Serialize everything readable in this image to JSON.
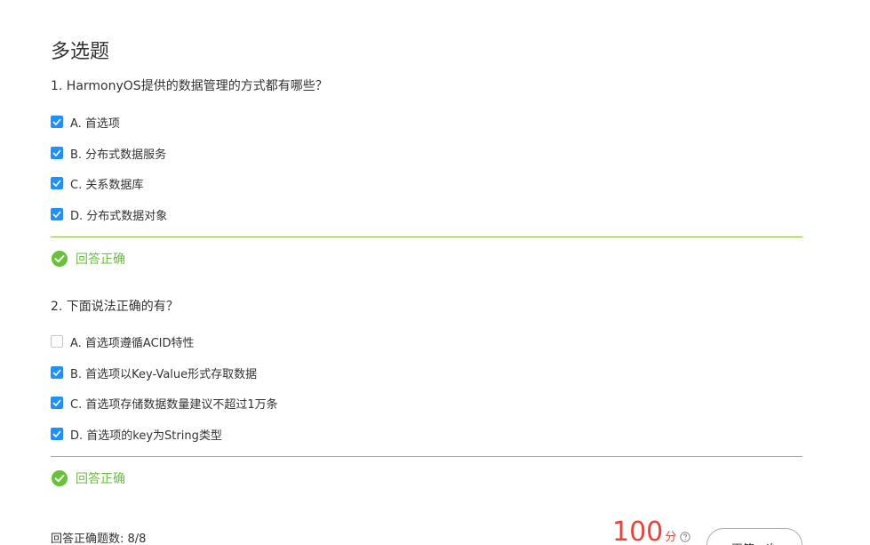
{
  "section_title": "多选题",
  "questions": [
    {
      "text": "1. HarmonyOS提供的数据管理的方式都有哪些？",
      "options": [
        {
          "label": "A. 首选项",
          "checked": true
        },
        {
          "label": "B. 分布式数据服务",
          "checked": true
        },
        {
          "label": "C. 关系数据库",
          "checked": true
        },
        {
          "label": "D. 分布式数据对象",
          "checked": true
        }
      ],
      "result": "回答正确"
    },
    {
      "text": "2. 下面说法正确的有？",
      "options": [
        {
          "label": "A. 首选项遵循ACID特性",
          "checked": false
        },
        {
          "label": "B. 首选项以Key-Value形式存取数据",
          "checked": true
        },
        {
          "label": "C. 首选项存储数据数量建议不超过1万条",
          "checked": true
        },
        {
          "label": "D. 首选项的key为String类型",
          "checked": true
        }
      ],
      "result": "回答正确"
    }
  ],
  "summary": {
    "label": "回答正确题数: 8/8",
    "score": "100",
    "score_unit": "分",
    "retry_label": "再答一次"
  },
  "colors": {
    "checkbox_checked": "#1e90ff",
    "correct_green": "#67c23a",
    "divider_green": "#8dc63f",
    "score_red": "#e8443a"
  },
  "icons": {
    "result": "check-circle-icon",
    "help": "question-circle-icon",
    "checked": "checkmark-icon"
  }
}
